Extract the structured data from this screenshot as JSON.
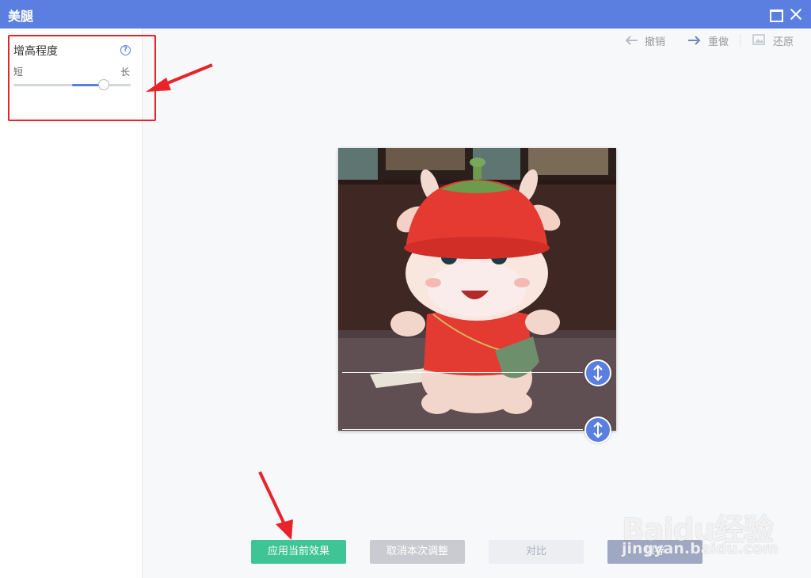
{
  "window": {
    "title": "美腿"
  },
  "sidebar": {
    "panel_title": "增高程度",
    "help_symbol": "?",
    "label_short": "短",
    "label_long": "长",
    "slider_value": 0.77,
    "slider_fill_start": 0.5
  },
  "toolbar": {
    "undo_label": "撤销",
    "redo_label": "重做",
    "restore_label": "还原"
  },
  "buttons": {
    "apply_label": "应用当前效果",
    "cancel_label": "取消本次调整",
    "compare_label": "对比",
    "save_label": "保存"
  },
  "watermark": {
    "brand": "Baidu经验",
    "url": "jingyan.baidu.com"
  },
  "colors": {
    "accent": "#5a7fe0",
    "apply": "#3fc495",
    "annotation": "#e8242a"
  }
}
